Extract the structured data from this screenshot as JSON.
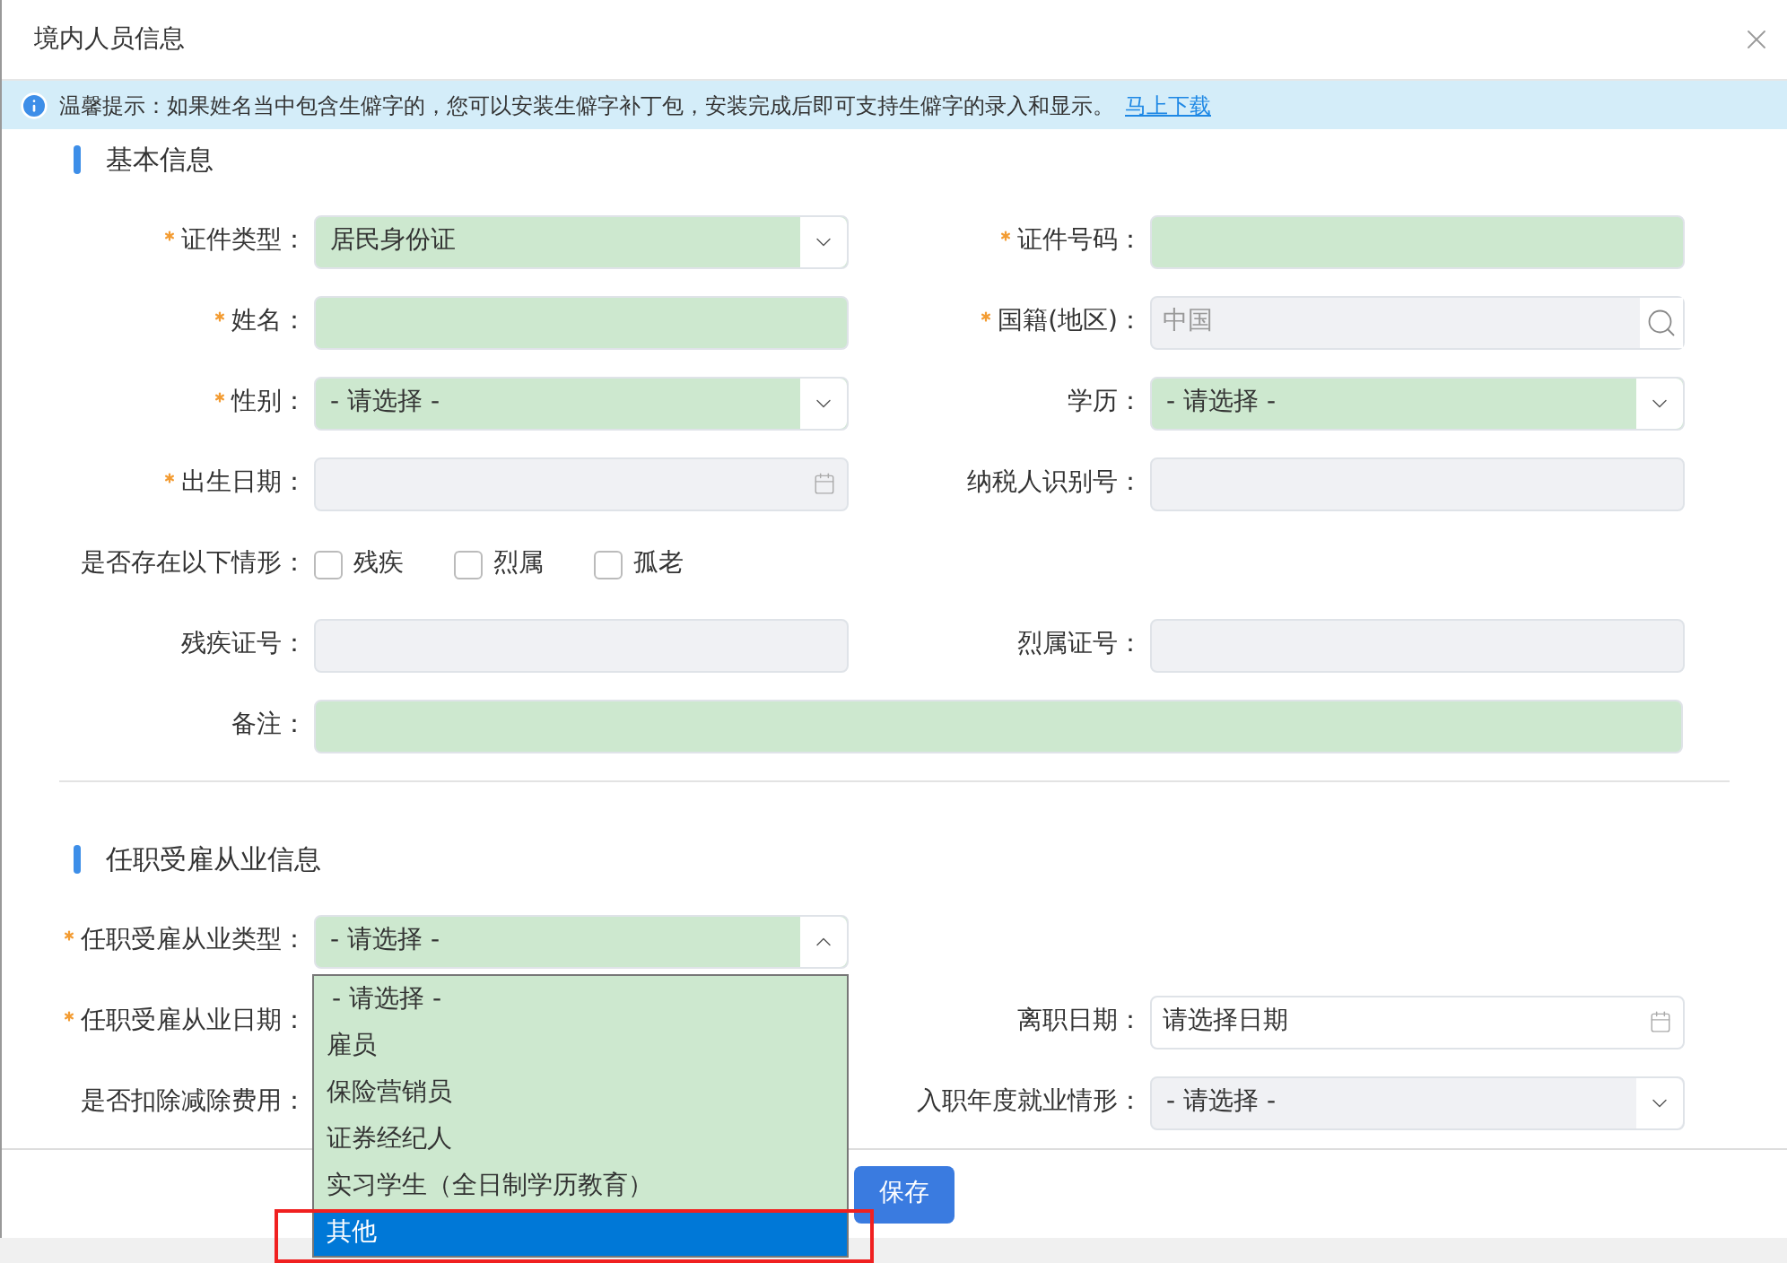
{
  "dialog": {
    "title": "境内人员信息"
  },
  "notice": {
    "text": "温馨提示：如果姓名当中包含生僻字的，您可以安装生僻字补丁包，安装完成后即可支持生僻字的录入和显示。",
    "link": "马上下载"
  },
  "sections": [
    {
      "title": "基本信息",
      "rows": [
        [
          {
            "label": "证件类型：",
            "required": true,
            "kind": "select",
            "value": "居民身份证",
            "highlighted": true,
            "disabled": false
          },
          {
            "label": "证件号码：",
            "required": true,
            "kind": "text",
            "highlighted": true,
            "disabled": false
          }
        ],
        [
          {
            "label": "姓名：",
            "required": true,
            "kind": "text",
            "highlighted": true,
            "disabled": false
          },
          {
            "label": "国籍(地区)：",
            "required": true,
            "kind": "lookup",
            "value": "中国",
            "disabled": true
          }
        ],
        [
          {
            "label": "性别：",
            "required": true,
            "kind": "select",
            "value": "- 请选择 -",
            "highlighted": true,
            "disabled": false
          },
          {
            "label": "学历：",
            "required": false,
            "kind": "select",
            "value": "- 请选择 -",
            "highlighted": true,
            "disabled": false
          }
        ],
        [
          {
            "label": "出生日期：",
            "required": true,
            "kind": "date",
            "disabled": true
          },
          {
            "label": "纳税人识别号：",
            "required": false,
            "kind": "text",
            "disabled": true
          }
        ],
        [
          {
            "label": "是否存在以下情形：",
            "required": false,
            "kind": "checkboxes",
            "options": [
              {
                "label": "残疾",
                "checked": false
              },
              {
                "label": "烈属",
                "checked": false
              },
              {
                "label": "孤老",
                "checked": false
              }
            ]
          }
        ],
        [
          {
            "label": "残疾证号：",
            "required": false,
            "kind": "text",
            "disabled": true
          },
          {
            "label": "烈属证号：",
            "required": false,
            "kind": "text",
            "disabled": true
          }
        ],
        [
          {
            "label": "备注：",
            "required": false,
            "kind": "wide",
            "highlighted": true,
            "disabled": false
          }
        ]
      ]
    },
    {
      "title": "任职受雇从业信息",
      "rows": [
        [
          {
            "label": "任职受雇从业类型：",
            "required": true,
            "kind": "select",
            "value": "- 请选择 -",
            "highlighted": true,
            "disabled": false,
            "expanded": true
          }
        ],
        [
          {
            "label": "任职受雇从业日期：",
            "required": true,
            "kind": "covered"
          },
          {
            "label": "离职日期：",
            "required": false,
            "kind": "date",
            "placeholder": "请选择日期",
            "highlighted": false,
            "disabled": false
          }
        ],
        [
          {
            "label": "是否扣除减除费用：",
            "required": false,
            "kind": "covered"
          },
          {
            "label": "入职年度就业情形：",
            "required": false,
            "kind": "select",
            "value": "- 请选择 -",
            "disabled": true
          }
        ]
      ],
      "dropdown": {
        "options": [
          {
            "label": "- 请选择 -",
            "selected": false
          },
          {
            "label": "雇员",
            "selected": false
          },
          {
            "label": "保险营销员",
            "selected": false
          },
          {
            "label": "证券经纪人",
            "selected": false
          },
          {
            "label": "实习学生（全日制学历教育）",
            "selected": false
          },
          {
            "label": "其他",
            "selected": true
          }
        ]
      }
    }
  ],
  "footer": {
    "button": "保存"
  }
}
